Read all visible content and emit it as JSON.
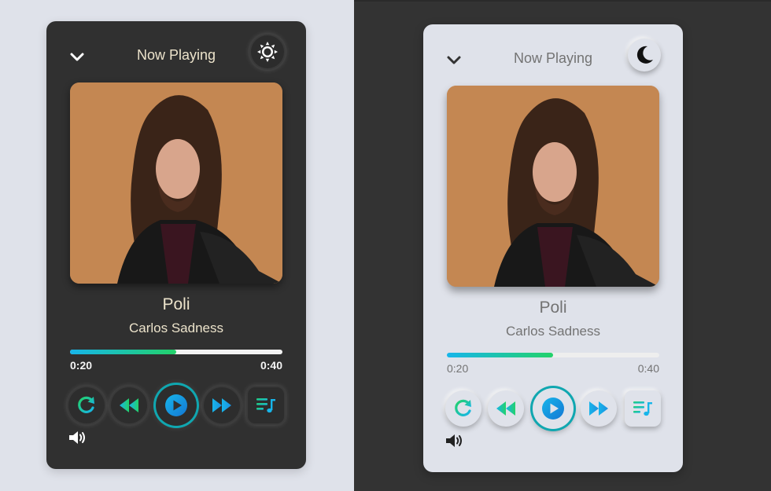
{
  "dark": {
    "header": {
      "title": "Now Playing",
      "collapse_icon": "chevron-down-icon",
      "theme_icon": "sun-icon"
    },
    "track": {
      "song": "Poli",
      "artist": "Carlos Sadness"
    },
    "progress": {
      "current": "0:20",
      "total": "0:40",
      "fraction": 0.5
    },
    "controls": [
      "repeat-icon",
      "rewind-icon",
      "play-icon",
      "fast-forward-icon",
      "playlist-icon"
    ],
    "volume_icon": "volume-icon"
  },
  "light": {
    "header": {
      "title": "Now Playing",
      "collapse_icon": "chevron-down-icon",
      "theme_icon": "moon-icon"
    },
    "track": {
      "song": "Poli",
      "artist": "Carlos Sadness"
    },
    "progress": {
      "current": "0:20",
      "total": "0:40",
      "fraction": 0.5
    },
    "controls": [
      "repeat-icon",
      "rewind-icon",
      "play-icon",
      "fast-forward-icon",
      "playlist-icon"
    ],
    "volume_icon": "volume-icon"
  },
  "colors": {
    "accent_blue": "#17b5ea",
    "accent_green": "#23d26a",
    "accent_teal": "#10a7b0",
    "dark_card": "#303030",
    "light_card": "#dfe2ea"
  }
}
